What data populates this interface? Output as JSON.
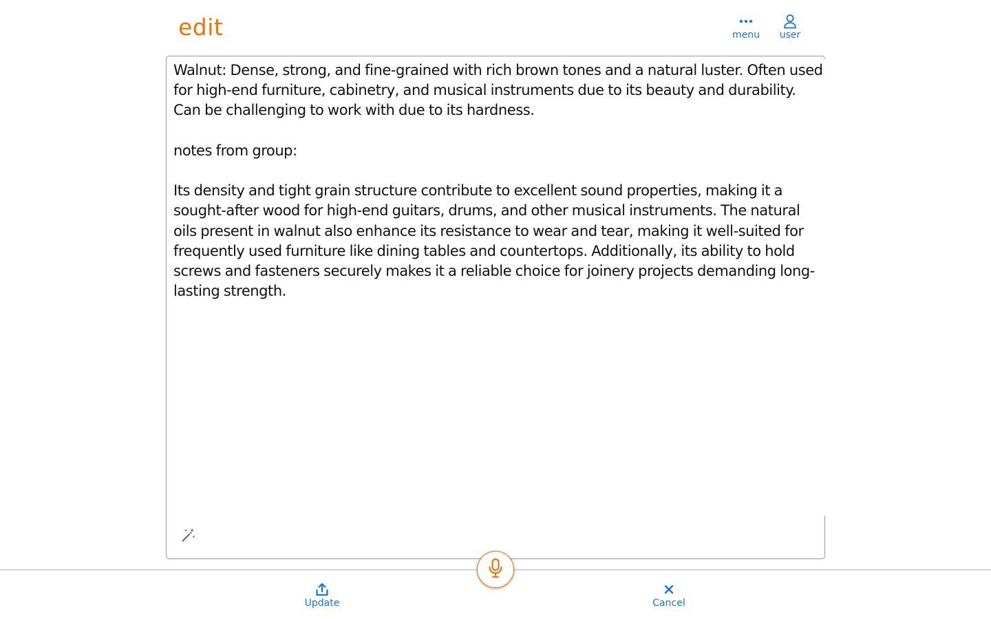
{
  "header": {
    "title": "edit",
    "menu_label": "menu",
    "user_label": "user"
  },
  "editor": {
    "text": "Walnut: Dense, strong, and fine-grained with rich brown tones and a natural luster. Often used for high-end furniture, cabinetry, and musical instruments due to its beauty and durability. Can be challenging to work with due to its hardness.\n\nnotes from group:\n\nIts density and tight grain structure contribute to excellent sound properties, making it a sought-after wood for high-end guitars, drums, and other musical instruments. The natural oils present in walnut also enhance its resistance to wear and tear, making it well-suited for frequently used furniture like dining tables and countertops. Additionally, its ability to hold screws and fasteners securely makes it a reliable choice for joinery projects demanding long-lasting strength.",
    "magic_icon": "magic-wand-icon"
  },
  "footer": {
    "update_label": "Update",
    "cancel_label": "Cancel",
    "mic_icon": "microphone-icon"
  },
  "colors": {
    "accent_orange": "#e8750e",
    "accent_blue": "#1a73d9",
    "text": "#111111",
    "border": "#9a9a9a"
  }
}
